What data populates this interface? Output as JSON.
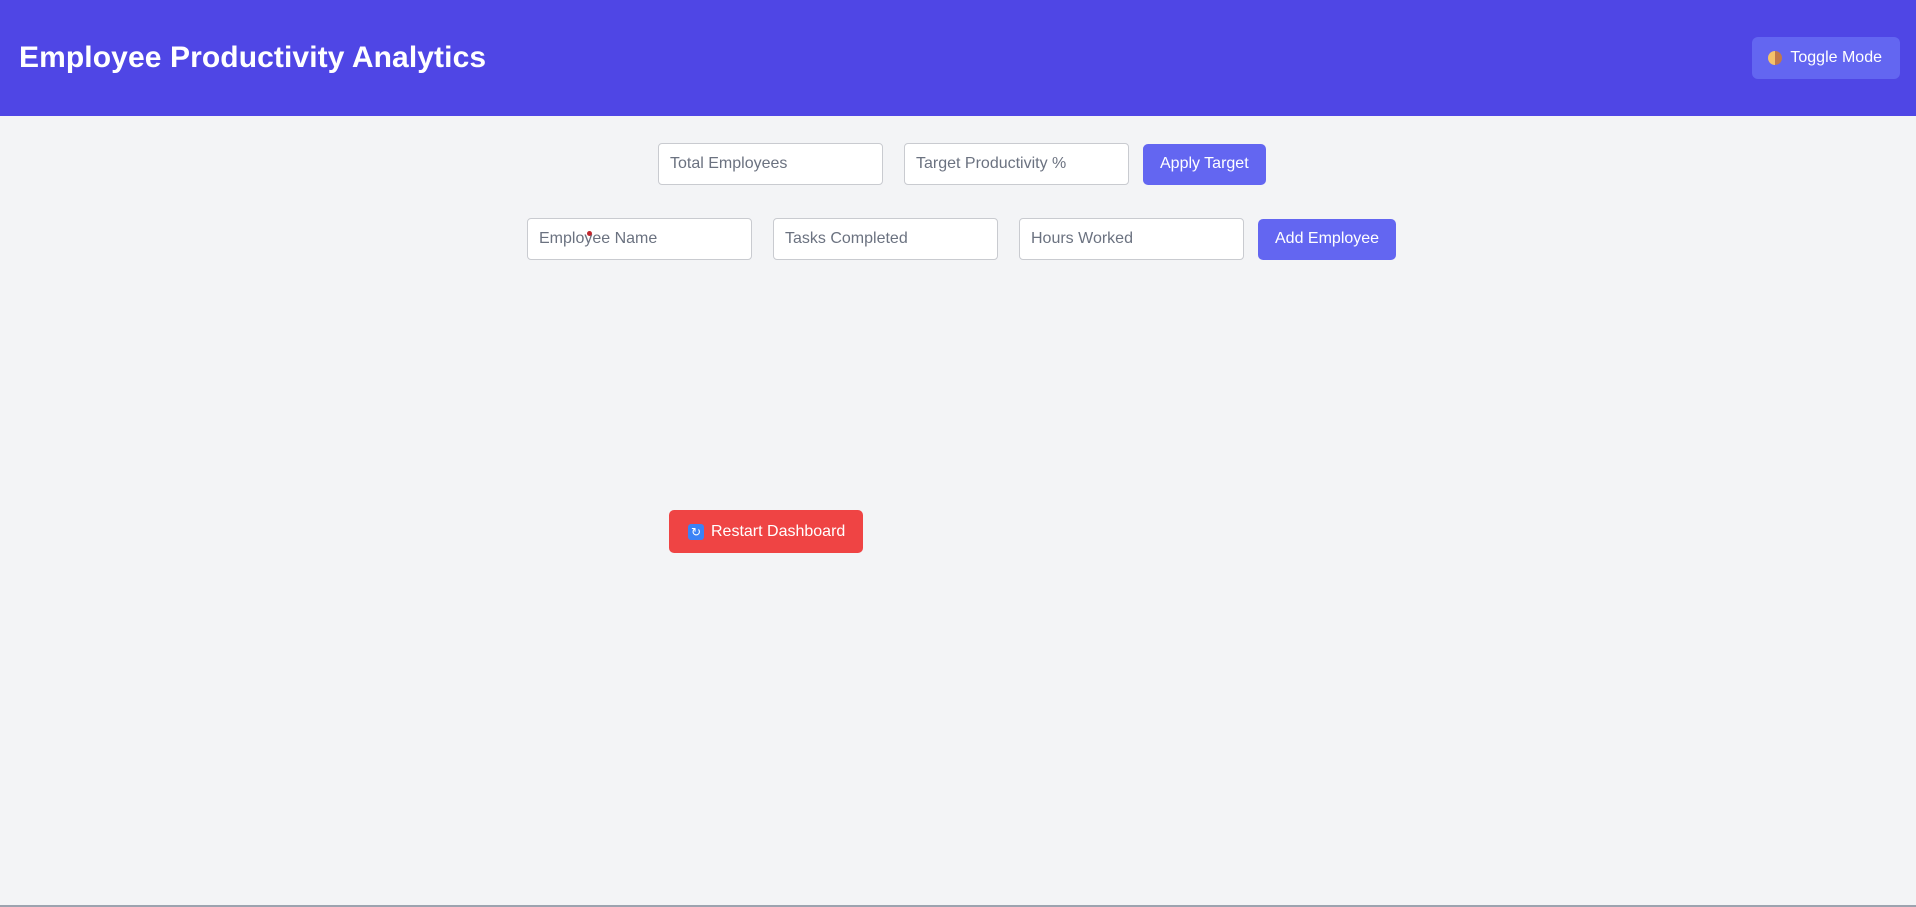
{
  "header": {
    "title": "Employee Productivity Analytics",
    "toggle_label": "Toggle Mode",
    "toggle_icon": "moon-icon",
    "background_color": "#4f46e5"
  },
  "target_form": {
    "total_employees_placeholder": "Total Employees",
    "target_productivity_placeholder": "Target Productivity %",
    "apply_label": "Apply Target"
  },
  "employee_form": {
    "name_placeholder": "Employee Name",
    "tasks_placeholder": "Tasks Completed",
    "hours_placeholder": "Hours Worked",
    "add_label": "Add Employee"
  },
  "restart": {
    "label": "Restart Dashboard",
    "icon": "refresh-icon",
    "color": "#ef4444"
  },
  "colors": {
    "accent": "#6366f1",
    "page_background": "#f3f4f6"
  }
}
